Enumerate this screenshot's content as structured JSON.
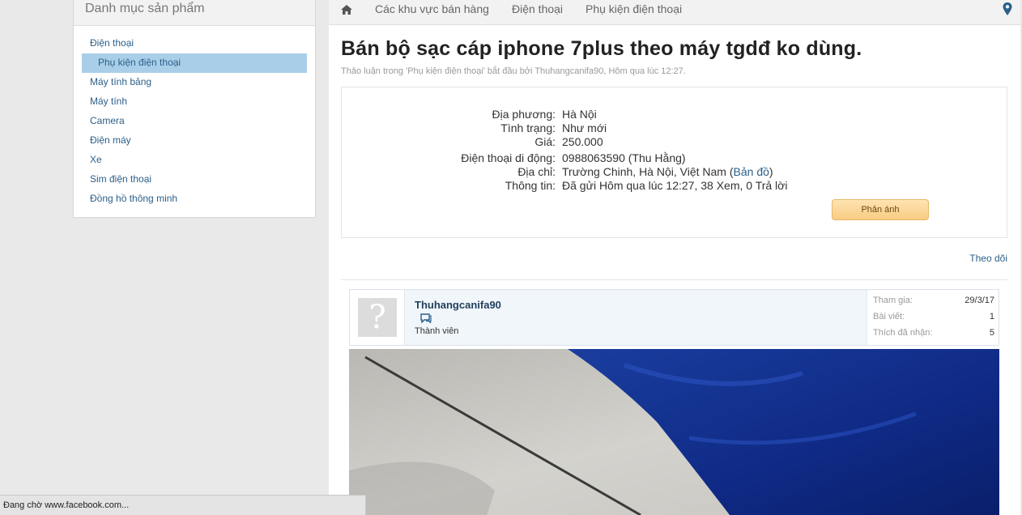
{
  "sidebar": {
    "title": "Danh mục sản phẩm",
    "items": [
      {
        "label": "Điện thoại"
      },
      {
        "label": "Phụ kiện điện thoại"
      },
      {
        "label": "Máy tính bảng"
      },
      {
        "label": "Máy tính"
      },
      {
        "label": "Camera"
      },
      {
        "label": "Điện máy"
      },
      {
        "label": "Xe"
      },
      {
        "label": "Sim điện thoại"
      },
      {
        "label": "Đồng hồ thông minh"
      }
    ],
    "active_index": 1
  },
  "breadcrumb": {
    "home_icon": "home-icon",
    "items": [
      "Các khu vực bán hàng",
      "Điện thoại",
      "Phụ kiện điện thoại"
    ],
    "right_icon": "map-pin-icon"
  },
  "thread": {
    "title": "Bán bộ sạc cáp iphone 7plus theo máy tgdđ ko dùng.",
    "meta": "Thảo luận trong 'Phụ kiện điện thoại' bắt đầu bởi Thuhangcanifa90, Hôm qua lúc 12:27."
  },
  "info": {
    "rows": [
      {
        "label": "Địa phương:",
        "value": "Hà Nội"
      },
      {
        "label": "Tình trạng:",
        "value": "Như mới"
      },
      {
        "label": "Giá:",
        "value": "250.000"
      },
      {
        "label": "Điện thoại di động:",
        "value": "0988063590 (Thu Hằng)"
      },
      {
        "label": "Địa chỉ:",
        "value": "Trường Chinh, Hà Nội, Việt Nam (",
        "link": "Bản đồ",
        "suffix": ")"
      },
      {
        "label": "Thông tin:",
        "value": "Đã gửi Hôm qua lúc 12:27, 38 Xem, 0 Trả lời"
      }
    ],
    "report_button": "Phản ánh"
  },
  "follow_link": "Theo dõi",
  "post": {
    "username": "Thuhangcanifa90",
    "user_title": "Thành viên",
    "avatar_glyph": "?",
    "stats": [
      {
        "label": "Tham gia:",
        "value": "29/3/17"
      },
      {
        "label": "Bài viết:",
        "value": "1"
      },
      {
        "label": "Thích đã nhận:",
        "value": "5"
      }
    ]
  },
  "status_bar": "Đang chờ www.facebook.com...",
  "colors": {
    "link": "#2b5f8a",
    "sidebar_active": "#a9cfe8",
    "report_button": "#f8cc82",
    "post_header_bg": "#f1f6fb"
  }
}
